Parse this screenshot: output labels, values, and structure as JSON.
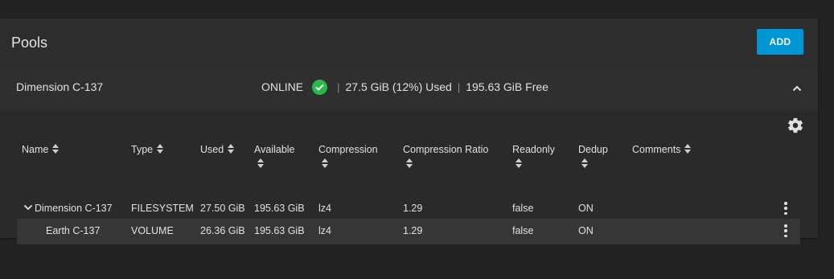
{
  "card": {
    "title": "Pools",
    "add_label": "ADD"
  },
  "pool": {
    "name": "Dimension C-137",
    "status": "ONLINE",
    "used": "27.5 GiB (12%) Used",
    "free": "195.63 GiB Free",
    "separator": "|",
    "status_color": "#28b94b"
  },
  "columns": [
    "Name",
    "Type",
    "Used",
    "Available",
    "Compression",
    "Compression Ratio",
    "Readonly",
    "Dedup",
    "Comments"
  ],
  "rows": [
    {
      "name": "Dimension C-137",
      "type": "FILESYSTEM",
      "used": "27.50 GiB",
      "available": "195.63 GiB",
      "compression": "lz4",
      "ratio": "1.29",
      "readonly": "false",
      "dedup": "ON",
      "comments": ""
    },
    {
      "name": "Earth C-137",
      "type": "VOLUME",
      "used": "26.36 GiB",
      "available": "195.63 GiB",
      "compression": "lz4",
      "ratio": "1.29",
      "readonly": "false",
      "dedup": "ON",
      "comments": ""
    }
  ],
  "icons": {
    "status": "check-circle-icon",
    "collapse": "chevron-up-icon",
    "settings": "gear-icon",
    "sort": "sort-icon",
    "expand": "chevron-down-icon",
    "actions": "more-vert-icon"
  },
  "colors": {
    "accent": "#0095d5",
    "background": "#232323",
    "card": "#2d2d2d"
  }
}
